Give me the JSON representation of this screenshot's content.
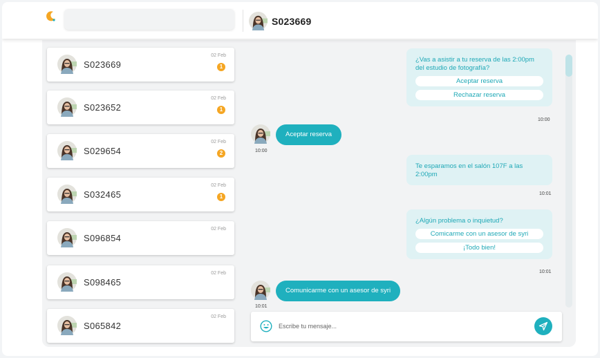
{
  "header": {
    "title": "S023669",
    "search_value": ""
  },
  "colors": {
    "accent": "#1fb0be",
    "bubble": "#dff2f4",
    "badge": "#f5a623"
  },
  "icons": [
    "logo-icon",
    "avatar",
    "emoji-icon",
    "send-icon"
  ],
  "conversations": [
    {
      "name": "S023669",
      "date": "02 Feb",
      "badge": "1"
    },
    {
      "name": "S023652",
      "date": "02 Feb",
      "badge": "1"
    },
    {
      "name": "S029654",
      "date": "02 Feb",
      "badge": "2"
    },
    {
      "name": "S032465",
      "date": "02 Feb",
      "badge": "1"
    },
    {
      "name": "S096854",
      "date": "02 Feb",
      "badge": ""
    },
    {
      "name": "S098465",
      "date": "02 Feb",
      "badge": ""
    },
    {
      "name": "S065842",
      "date": "02 Feb",
      "badge": ""
    }
  ],
  "messages": {
    "m1": {
      "text": "¿Vas a asistir a tu reserva de las 2:00pm del estudio de fotografía?",
      "options": [
        "Aceptar reserva",
        "Rechazar reserva"
      ],
      "time": "10:00"
    },
    "m2": {
      "text": "Aceptar reserva",
      "time": "10:00"
    },
    "m3": {
      "text": "Te esparamos en el salón 107F a las 2:00pm",
      "time": "10:01"
    },
    "m4": {
      "text": "¿Algún problema o inquietud?",
      "options": [
        "Comicarme con un asesor de syri",
        "¡Todo bien!"
      ],
      "time": "10:01"
    },
    "m5": {
      "text": "Comunicarme con un asesor de syri",
      "time": "10:01"
    }
  },
  "composer": {
    "placeholder": "Escribe tu mensaje...",
    "value": ""
  }
}
